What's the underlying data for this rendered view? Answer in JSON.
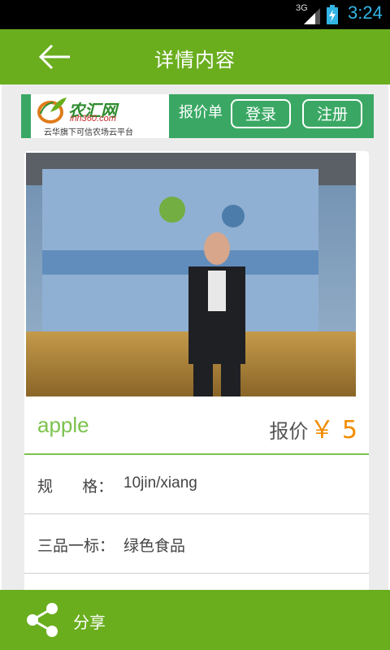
{
  "status_bar": {
    "network": "3G",
    "time": "3:24"
  },
  "header": {
    "title": "详情内容"
  },
  "banner": {
    "logo_name": "农汇网",
    "logo_url": "inh360.com",
    "logo_tagline": "云华旗下可信农场云平台",
    "label": "报价单",
    "login_label": "登录",
    "register_label": "注册"
  },
  "product": {
    "name": "apple",
    "price_label": "报价",
    "price_value": "￥ 5",
    "specs": [
      {
        "label": "规      格：",
        "value": "10jin/xiang"
      },
      {
        "label": "三品一标：",
        "value": "绿色食品"
      }
    ]
  },
  "footer": {
    "share_label": "分享"
  },
  "colors": {
    "primary": "#6aae1e",
    "banner_green": "#3aa864",
    "product_name": "#7cc24e",
    "price": "#f08c00",
    "status_time": "#33b5e5"
  },
  "icons": {
    "back": "arrow-left-icon",
    "share": "share-icon",
    "signal": "signal-icon",
    "battery": "battery-charging-icon"
  }
}
